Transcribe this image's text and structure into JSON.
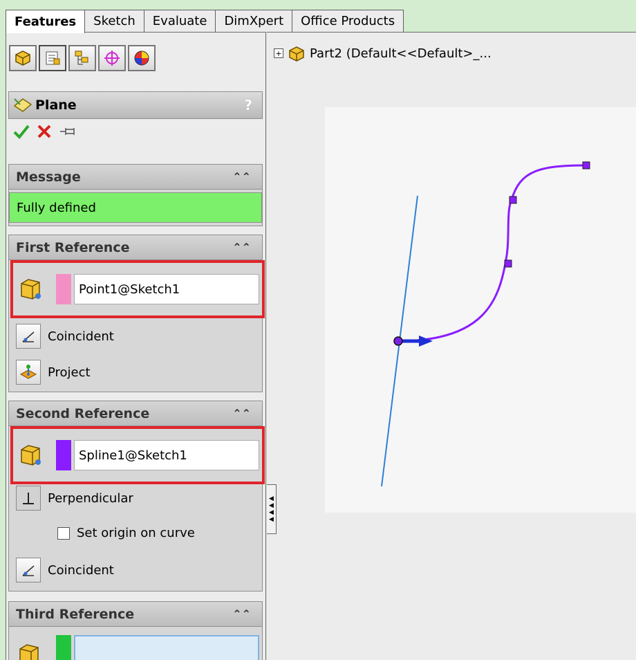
{
  "tabs": [
    {
      "label": "Features",
      "active": true
    },
    {
      "label": "Sketch",
      "active": false
    },
    {
      "label": "Evaluate",
      "active": false
    },
    {
      "label": "DimXpert",
      "active": false
    },
    {
      "label": "Office Products",
      "active": false
    }
  ],
  "panel_icons": [
    "feature-manager-icon",
    "property-manager-icon",
    "configuration-manager-icon",
    "dimxpert-manager-icon",
    "display-manager-icon"
  ],
  "property_manager": {
    "title": "Plane",
    "help_label": "?",
    "actions": [
      "ok-check-icon",
      "cancel-x-icon",
      "pushpin-icon"
    ]
  },
  "message": {
    "header": "Message",
    "text": "Fully defined",
    "status_color": "#7cf06a"
  },
  "first_reference": {
    "header": "First Reference",
    "value": "Point1@Sketch1",
    "swatch_color": "#f48fc5",
    "options": [
      {
        "label": "Coincident",
        "icon": "coincident-icon"
      },
      {
        "label": "Project",
        "icon": "project-icon"
      }
    ]
  },
  "second_reference": {
    "header": "Second Reference",
    "value": "Spline1@Sketch1",
    "swatch_color": "#8a1dff",
    "options": [
      {
        "label": "Perpendicular",
        "icon": "perpendicular-icon"
      },
      {
        "label": "Set origin on curve",
        "checked": false
      },
      {
        "label": "Coincident",
        "icon": "coincident-icon"
      }
    ]
  },
  "third_reference": {
    "header": "Third Reference",
    "value": "",
    "swatch_color": "#22c33d"
  },
  "tree": {
    "expand": "+",
    "label": "Part2  (Default<<Default>_..."
  },
  "colors": {
    "highlight": "#e0252b",
    "spline": "#8a1dff",
    "line": "#2f7fd6",
    "arrow": "#1f2fd6"
  }
}
